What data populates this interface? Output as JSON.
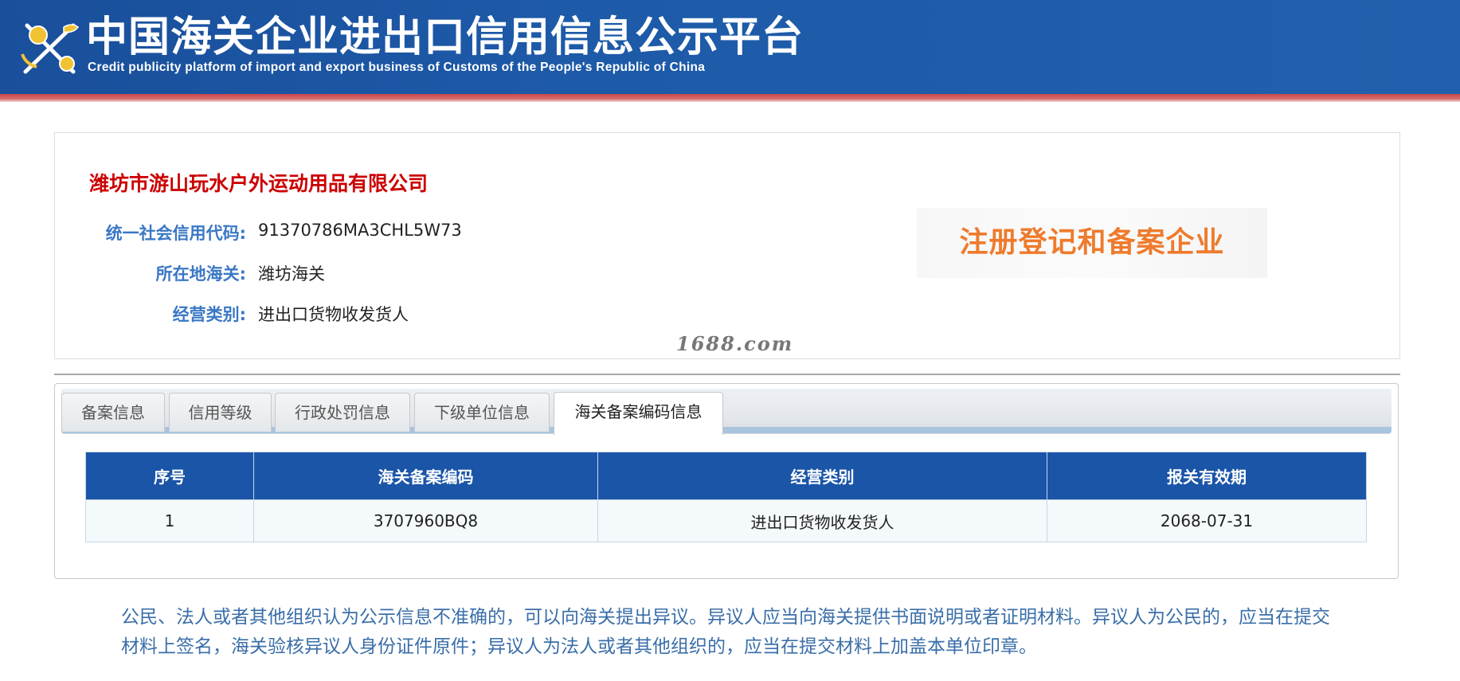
{
  "header": {
    "title": "中国海关企业进出口信用信息公示平台",
    "subtitle": "Credit publicity platform of import and export business of Customs of the People's Republic of China",
    "logo_icon": "customs-emblem-icon",
    "colors": {
      "header_blue": "#1d5aa8",
      "accent_red": "#c8474a"
    }
  },
  "company": {
    "name": "潍坊市游山玩水户外运动用品有限公司",
    "fields": [
      {
        "label": "统一社会信用代码:",
        "value": "91370786MA3CHL5W73"
      },
      {
        "label": "所在地海关:",
        "value": "潍坊海关"
      },
      {
        "label": "经营类别:",
        "value": "进出口货物收发货人"
      }
    ],
    "status": "注册登记和备案企业",
    "watermark": "1688.com"
  },
  "tabs": [
    {
      "label": "备案信息",
      "active": false
    },
    {
      "label": "信用等级",
      "active": false
    },
    {
      "label": "行政处罚信息",
      "active": false
    },
    {
      "label": "下级单位信息",
      "active": false
    },
    {
      "label": "海关备案编码信息",
      "active": true
    }
  ],
  "table": {
    "headers": [
      "序号",
      "海关备案编码",
      "经营类别",
      "报关有效期"
    ],
    "rows": [
      [
        "1",
        "3707960BQ8",
        "进出口货物收发货人",
        "2068-07-31"
      ]
    ]
  },
  "notice": "公民、法人或者其他组织认为公示信息不准确的，可以向海关提出异议。异议人应当向海关提供书面说明或者证明材料。异议人为公民的，应当在提交材料上签名，海关验核异议人身份证件原件；异议人为法人或者其他组织的，应当在提交材料上加盖本单位印章。"
}
